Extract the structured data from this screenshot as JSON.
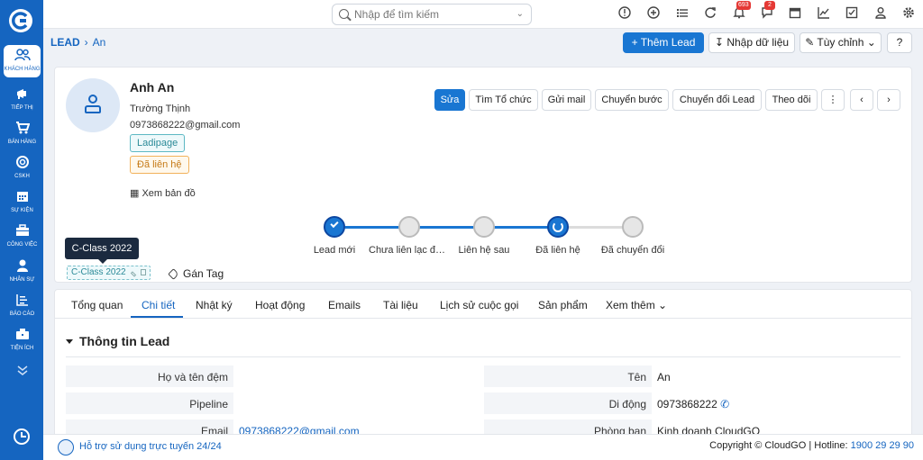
{
  "sidebar": {
    "items": [
      {
        "label": "KHÁCH HÀNG",
        "icon": "users-icon"
      },
      {
        "label": "TIẾP THỊ",
        "icon": "megaphone-icon"
      },
      {
        "label": "BÁN HÀNG",
        "icon": "cart-icon"
      },
      {
        "label": "CSKH",
        "icon": "support-icon"
      },
      {
        "label": "SỰ KIỆN",
        "icon": "calendar-icon"
      },
      {
        "label": "CÔNG VIỆC",
        "icon": "briefcase-icon"
      },
      {
        "label": "NHÂN SỰ",
        "icon": "person-icon"
      },
      {
        "label": "BÁO CÁO",
        "icon": "report-icon"
      },
      {
        "label": "TIỆN ÍCH",
        "icon": "utilities-icon"
      }
    ]
  },
  "topbar": {
    "search_placeholder": "Nhập để tìm kiếm",
    "notifications_count": "693",
    "messages_count": "2"
  },
  "breadcrumb": {
    "root": "LEAD",
    "current": "An"
  },
  "header_buttons": {
    "add_lead": "Thêm Lead",
    "import": "Nhập dữ liệu",
    "customize": "Tùy chỉnh"
  },
  "lead": {
    "name": "Anh An",
    "company": "Trường Thịnh",
    "email": "0973868222@gmail.com",
    "source_tag": "Ladipage",
    "status_tag": "Đã liên hệ",
    "map_link": "Xem bản đồ"
  },
  "actions": {
    "edit": "Sửa",
    "find_org": "Tìm Tổ chức",
    "send_mail": "Gửi mail",
    "move_step": "Chuyển bước",
    "convert": "Chuyển đổi Lead",
    "follow": "Theo dõi"
  },
  "pipeline": {
    "steps": [
      {
        "label": "Lead mới",
        "state": "done"
      },
      {
        "label": "Chưa liên lạc được",
        "state": "todo"
      },
      {
        "label": "Liên hệ sau",
        "state": "todo"
      },
      {
        "label": "Đã liên hệ",
        "state": "current"
      },
      {
        "label": "Đã chuyển đổi",
        "state": "todo"
      }
    ],
    "active_color": "#1976d2"
  },
  "tags": {
    "tooltip": "C-Class 2022",
    "chip": "C-Class 2022",
    "add_tag": "Gán Tag"
  },
  "tabs": [
    "Tổng quan",
    "Chi tiết",
    "Nhật ký",
    "Hoạt động",
    "Emails",
    "Tài liệu",
    "Lịch sử cuộc gọi",
    "Sản phẩm",
    "Xem thêm"
  ],
  "active_tab": "Chi tiết",
  "section": {
    "title": "Thông tin Lead",
    "left_fields": [
      {
        "label": "Họ và tên đệm",
        "value": ""
      },
      {
        "label": "Pipeline",
        "value": ""
      },
      {
        "label": "Email",
        "value": "0973868222@gmail.com"
      }
    ],
    "right_fields": [
      {
        "label": "Tên",
        "value": "An"
      },
      {
        "label": "Di động",
        "value": "0973868222"
      },
      {
        "label": "Phòng ban",
        "value": "Kinh doanh CloudGO"
      }
    ]
  },
  "footer": {
    "support": "Hỗ trợ sử dụng trực tuyến 24/24",
    "copyright": "Copyright © CloudGO",
    "hotline_label": "| Hotline:",
    "hotline": "1900 29 29 90"
  },
  "colors": {
    "brand": "#1565c0",
    "primary": "#1976d2"
  }
}
